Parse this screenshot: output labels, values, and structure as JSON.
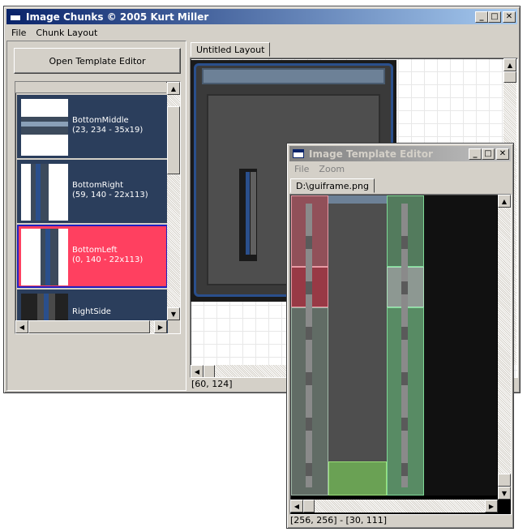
{
  "main_window": {
    "title": "Image Chunks © 2005 Kurt Miller",
    "menu": [
      "File",
      "Chunk Layout"
    ],
    "open_editor_button": "Open Template Editor",
    "chunks": [
      {
        "name": "BottomMiddle",
        "info": "(23, 234 - 35x19)",
        "selected": false
      },
      {
        "name": "BottomRight",
        "info": "(59, 140 - 22x113)",
        "selected": false
      },
      {
        "name": "BottomLeft",
        "info": "(0, 140 - 22x113)",
        "selected": true
      },
      {
        "name": "RightSide",
        "info": "",
        "selected": false
      }
    ],
    "layout_tab": "Untitled Layout",
    "status": "[60, 124]"
  },
  "editor_window": {
    "title": "Image Template Editor",
    "menu": [
      "File",
      "Zoom"
    ],
    "tab": "D:\\guiframe.png",
    "status": "[256, 256] - [30, 111]"
  },
  "colors": {
    "titlebar_active": "#0a246a",
    "chunk_bg": "#2b3e5c",
    "chunk_selected": "#ff4060",
    "frame_blue": "#2a4f8c",
    "chunk_red_overlay": "#d05a6a",
    "chunk_green_overlay": "#6ee08a"
  },
  "icons": {
    "app": "window-icon",
    "minimize": "minimize-icon",
    "maximize": "maximize-icon",
    "close": "close-icon"
  }
}
